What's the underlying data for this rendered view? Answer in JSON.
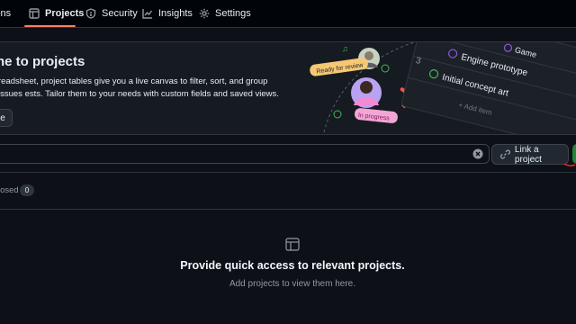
{
  "tabs": [
    {
      "label": "ions",
      "icon": "none"
    },
    {
      "label": "Projects",
      "icon": "table-icon",
      "active": true
    },
    {
      "label": "Security",
      "icon": "shield-icon"
    },
    {
      "label": "Insights",
      "icon": "graph-icon"
    },
    {
      "label": "Settings",
      "icon": "gear-icon"
    }
  ],
  "banner": {
    "title": "ne to projects",
    "description": "readsheet, project tables give you a live canvas to filter, sort, and group issues ests. Tailor them to your needs with custom fields and saved views.",
    "button_label": "e",
    "illustration": {
      "status_ready": "Ready for review",
      "status_progress": "In progress",
      "row_numbers": [
        "2",
        "3"
      ],
      "row_items": [
        "Game",
        "Engine prototype",
        "Initial concept art"
      ],
      "add_item": "+ Add item"
    }
  },
  "toolbar": {
    "link_project_label": "Link a project"
  },
  "filter": {
    "closed_label": "losed",
    "closed_count": "0"
  },
  "empty_state": {
    "title": "Provide quick access to relevant projects.",
    "subtitle": "Add projects to view them here."
  },
  "colors": {
    "background": "#0d1117",
    "active_tab_underline": "#f78166",
    "primary_button": "#238636",
    "ready_badge": "#f7c873",
    "progress_badge": "#f2a6d6"
  }
}
